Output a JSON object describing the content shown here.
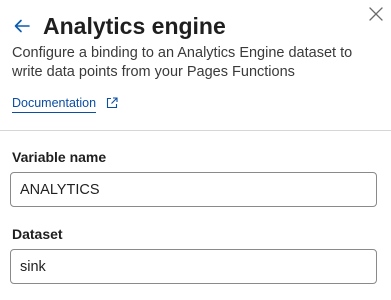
{
  "header": {
    "title": "Analytics engine",
    "description": "Configure a binding to an Analytics Engine dataset to write data points from your Pages Functions",
    "documentation_link": "Documentation",
    "back_icon": "arrow-left-icon",
    "close_icon": "close-icon",
    "external_icon": "external-link-icon"
  },
  "form": {
    "variable_name": {
      "label": "Variable name",
      "value": "ANALYTICS"
    },
    "dataset": {
      "label": "Dataset",
      "value": "sink"
    }
  },
  "colors": {
    "link": "#0b4ea2",
    "back_arrow": "#0b5cad",
    "border": "#8a8a8a",
    "divider": "#d6d6d6"
  }
}
